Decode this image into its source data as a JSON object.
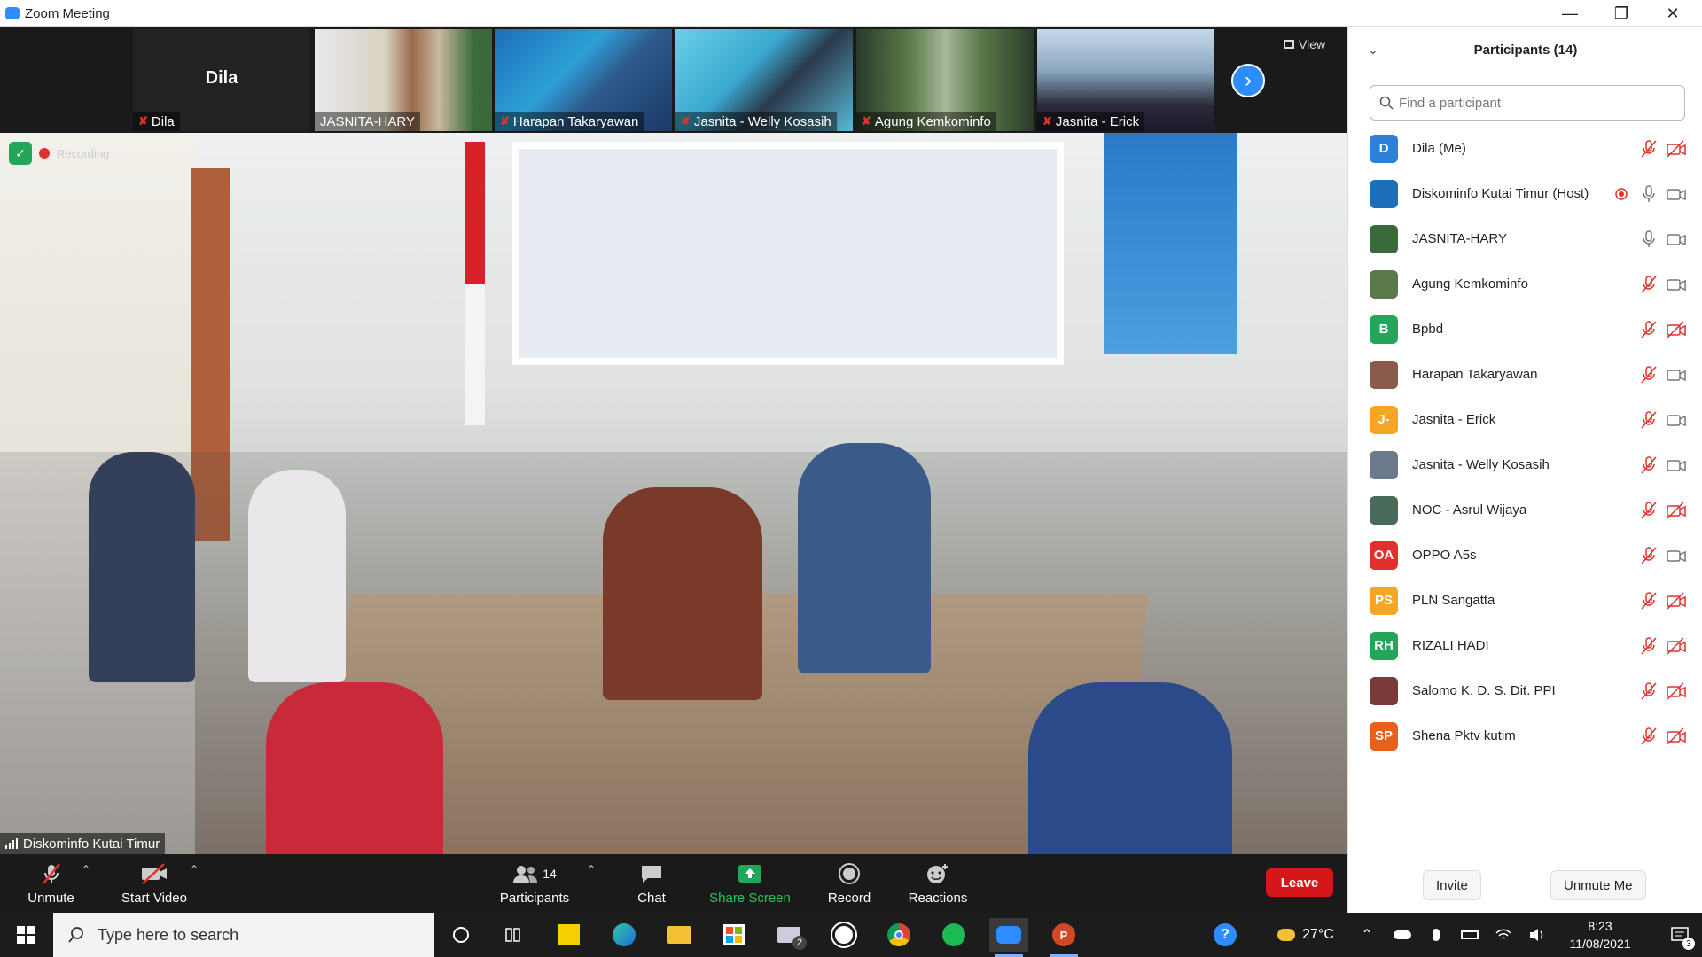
{
  "window": {
    "title": "Zoom Meeting",
    "controls": [
      "minimize-icon",
      "restore-icon",
      "close-icon"
    ]
  },
  "thumbnails": [
    {
      "name": "Dila",
      "big_name": "Dila",
      "muted": true,
      "video": false
    },
    {
      "name": "JASNITA-HARY",
      "muted": false,
      "video": true
    },
    {
      "name": "Harapan Takaryawan",
      "muted": true,
      "video": true
    },
    {
      "name": "Jasnita - Welly Kosasih",
      "muted": true,
      "video": true
    },
    {
      "name": "Agung Kemkominfo",
      "muted": true,
      "video": true
    },
    {
      "name": "Jasnita - Erick",
      "muted": true,
      "video": true
    }
  ],
  "view_label": "View",
  "main_video": {
    "speaker_name": "Diskominfo Kutai Timur",
    "recording_label": "Recording"
  },
  "toolbar": {
    "unmute": "Unmute",
    "start_video": "Start Video",
    "participants": "Participants",
    "participants_count": "14",
    "chat": "Chat",
    "share_screen": "Share Screen",
    "record": "Record",
    "reactions": "Reactions",
    "leave": "Leave"
  },
  "panel": {
    "title": "Participants (14)",
    "search_placeholder": "Find a participant",
    "invite": "Invite",
    "unmute_me": "Unmute Me",
    "participants": [
      {
        "name": "Dila (Me)",
        "avatar": "D",
        "color": "#2d7fd8",
        "mic": "muted",
        "cam": "off"
      },
      {
        "name": "Diskominfo Kutai Timur (Host)",
        "avatar": "",
        "color": "#1b6fb8",
        "mic": "on",
        "cam": "on",
        "recording": true
      },
      {
        "name": "JASNITA-HARY",
        "avatar": "",
        "color": "#3a6a3a",
        "mic": "on",
        "cam": "on"
      },
      {
        "name": "Agung Kemkominfo",
        "avatar": "",
        "color": "#5a7a4a",
        "mic": "muted",
        "cam": "on"
      },
      {
        "name": "Bpbd",
        "avatar": "B",
        "color": "#23a55a",
        "mic": "muted",
        "cam": "off"
      },
      {
        "name": "Harapan Takaryawan",
        "avatar": "",
        "color": "#8a5a4a",
        "mic": "muted",
        "cam": "on"
      },
      {
        "name": "Jasnita - Erick",
        "avatar": "J-",
        "color": "#f5a623",
        "mic": "muted",
        "cam": "on"
      },
      {
        "name": "Jasnita - Welly Kosasih",
        "avatar": "",
        "color": "#6a7a8a",
        "mic": "muted",
        "cam": "on"
      },
      {
        "name": "NOC - Asrul Wijaya",
        "avatar": "",
        "color": "#4a6a5a",
        "mic": "muted",
        "cam": "off"
      },
      {
        "name": "OPPO A5s",
        "avatar": "OA",
        "color": "#e0312c",
        "mic": "muted",
        "cam": "on"
      },
      {
        "name": "PLN Sangatta",
        "avatar": "PS",
        "color": "#f5a623",
        "mic": "muted",
        "cam": "off"
      },
      {
        "name": "RIZALI HADI",
        "avatar": "RH",
        "color": "#23a55a",
        "mic": "muted",
        "cam": "off"
      },
      {
        "name": "Salomo K. D. S. Dit. PPI",
        "avatar": "",
        "color": "#7a3a3a",
        "mic": "muted",
        "cam": "off"
      },
      {
        "name": "Shena Pktv kutim",
        "avatar": "SP",
        "color": "#e8601c",
        "mic": "muted",
        "cam": "off"
      }
    ]
  },
  "taskbar": {
    "search_placeholder": "Type here to search",
    "mail_badge": "2",
    "temperature": "27°C",
    "time": "8:23",
    "date": "11/08/2021",
    "notification_count": "3"
  },
  "colors": {
    "accent": "#2d8cff",
    "leave": "#d5171a",
    "muted_red": "#e0312c",
    "share_green": "#23a55a"
  }
}
